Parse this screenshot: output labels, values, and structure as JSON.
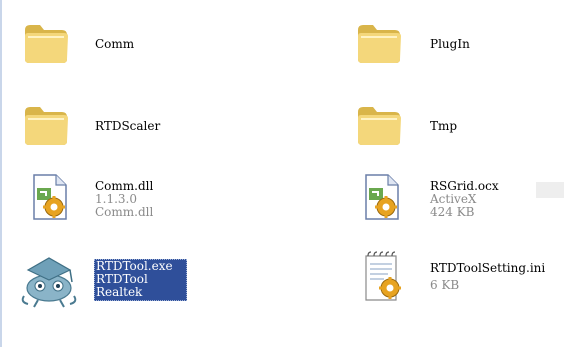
{
  "files": [
    {
      "name": "Comm",
      "details": []
    },
    {
      "name": "PlugIn",
      "details": []
    },
    {
      "name": "RTDScaler",
      "details": []
    },
    {
      "name": "Tmp",
      "details": []
    },
    {
      "name": "Comm.dll",
      "details": [
        "1.1.3.0",
        "Comm.dll"
      ]
    },
    {
      "name": "RSGrid.ocx",
      "details": [
        "ActiveX",
        "424 KB"
      ]
    },
    {
      "name": "RTDTool.exe",
      "details": [
        "RTDTool",
        "Realtek"
      ]
    },
    {
      "name": "RTDToolSetting.ini",
      "details": [
        "6 KB"
      ]
    }
  ],
  "icons": {
    "folder": "folder-icon",
    "dll": "dll-file-icon",
    "ocx": "activex-file-icon",
    "exe": "application-icon",
    "ini": "settings-file-icon"
  },
  "colors": {
    "selection": "#2f4f9a",
    "folder": "#f4d77b",
    "detail_text": "#8a8a8a"
  }
}
